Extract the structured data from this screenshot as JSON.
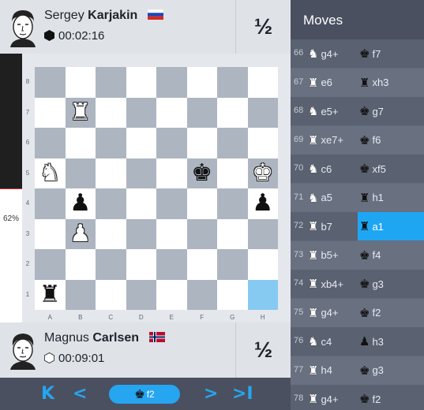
{
  "top_player": {
    "first_name": "Sergey",
    "last_name": "Karjakin",
    "clock": "00:02:16",
    "score": "½",
    "flag": "russia-flag"
  },
  "bottom_player": {
    "first_name": "Magnus",
    "last_name": "Carlsen",
    "clock": "00:09:01",
    "score": "½",
    "flag": "norway-flag"
  },
  "eval": {
    "white_pct": "38%",
    "black_pct": "62%"
  },
  "board": {
    "ranks": [
      "8",
      "7",
      "6",
      "5",
      "4",
      "3",
      "2",
      "1"
    ],
    "files": [
      "A",
      "B",
      "C",
      "D",
      "E",
      "F",
      "G",
      "H"
    ],
    "pieces": [
      {
        "square": "b7",
        "glyph": "♜",
        "color": "w",
        "name": "white-rook"
      },
      {
        "square": "a5",
        "glyph": "♞",
        "color": "w",
        "name": "white-knight"
      },
      {
        "square": "f5",
        "glyph": "♚",
        "color": "b",
        "name": "black-king"
      },
      {
        "square": "h5",
        "glyph": "♚",
        "color": "w",
        "name": "white-king"
      },
      {
        "square": "b4",
        "glyph": "♟",
        "color": "b",
        "name": "black-pawn"
      },
      {
        "square": "h4",
        "glyph": "♟",
        "color": "b",
        "name": "black-pawn"
      },
      {
        "square": "b3",
        "glyph": "♟",
        "color": "w",
        "name": "white-pawn"
      },
      {
        "square": "a1",
        "glyph": "♜",
        "color": "b",
        "name": "black-rook"
      }
    ],
    "highlight": "h1"
  },
  "nav": {
    "first": "K",
    "prev": "<",
    "current_move": "f2",
    "current_piece": "♚",
    "next": ">",
    "last": ">I"
  },
  "moves_panel": {
    "title": "Moves",
    "rows": [
      {
        "num": "66",
        "w_piece": "♞",
        "w_move": "g4+",
        "b_piece": "♚",
        "b_move": "f7"
      },
      {
        "num": "67",
        "w_piece": "♜",
        "w_move": "e6",
        "b_piece": "♜",
        "b_move": "xh3"
      },
      {
        "num": "68",
        "w_piece": "♞",
        "w_move": "e5+",
        "b_piece": "♚",
        "b_move": "g7"
      },
      {
        "num": "69",
        "w_piece": "♜",
        "w_move": "xe7+",
        "b_piece": "♚",
        "b_move": "f6"
      },
      {
        "num": "70",
        "w_piece": "♞",
        "w_move": "c6",
        "b_piece": "♚",
        "b_move": "xf5"
      },
      {
        "num": "71",
        "w_piece": "♞",
        "w_move": "a5",
        "b_piece": "♜",
        "b_move": "h1"
      },
      {
        "num": "72",
        "w_piece": "♜",
        "w_move": "b7",
        "b_piece": "♜",
        "b_move": "a1"
      },
      {
        "num": "73",
        "w_piece": "♜",
        "w_move": "b5+",
        "b_piece": "♚",
        "b_move": "f4"
      },
      {
        "num": "74",
        "w_piece": "♜",
        "w_move": "xb4+",
        "b_piece": "♚",
        "b_move": "g3"
      },
      {
        "num": "75",
        "w_piece": "♜",
        "w_move": "g4+",
        "b_piece": "♚",
        "b_move": "f2"
      },
      {
        "num": "76",
        "w_piece": "♞",
        "w_move": "c4",
        "b_piece": "♟",
        "b_move": "h3"
      },
      {
        "num": "77",
        "w_piece": "♜",
        "w_move": "h4",
        "b_piece": "♚",
        "b_move": "g3"
      },
      {
        "num": "78",
        "w_piece": "♜",
        "w_move": "g4+",
        "b_piece": "♚",
        "b_move": "f2"
      }
    ],
    "selected": "72b"
  },
  "colors": {
    "accent": "#26a5f0",
    "selected": "#1fa6f3",
    "highlight_square": "#86caf2"
  }
}
